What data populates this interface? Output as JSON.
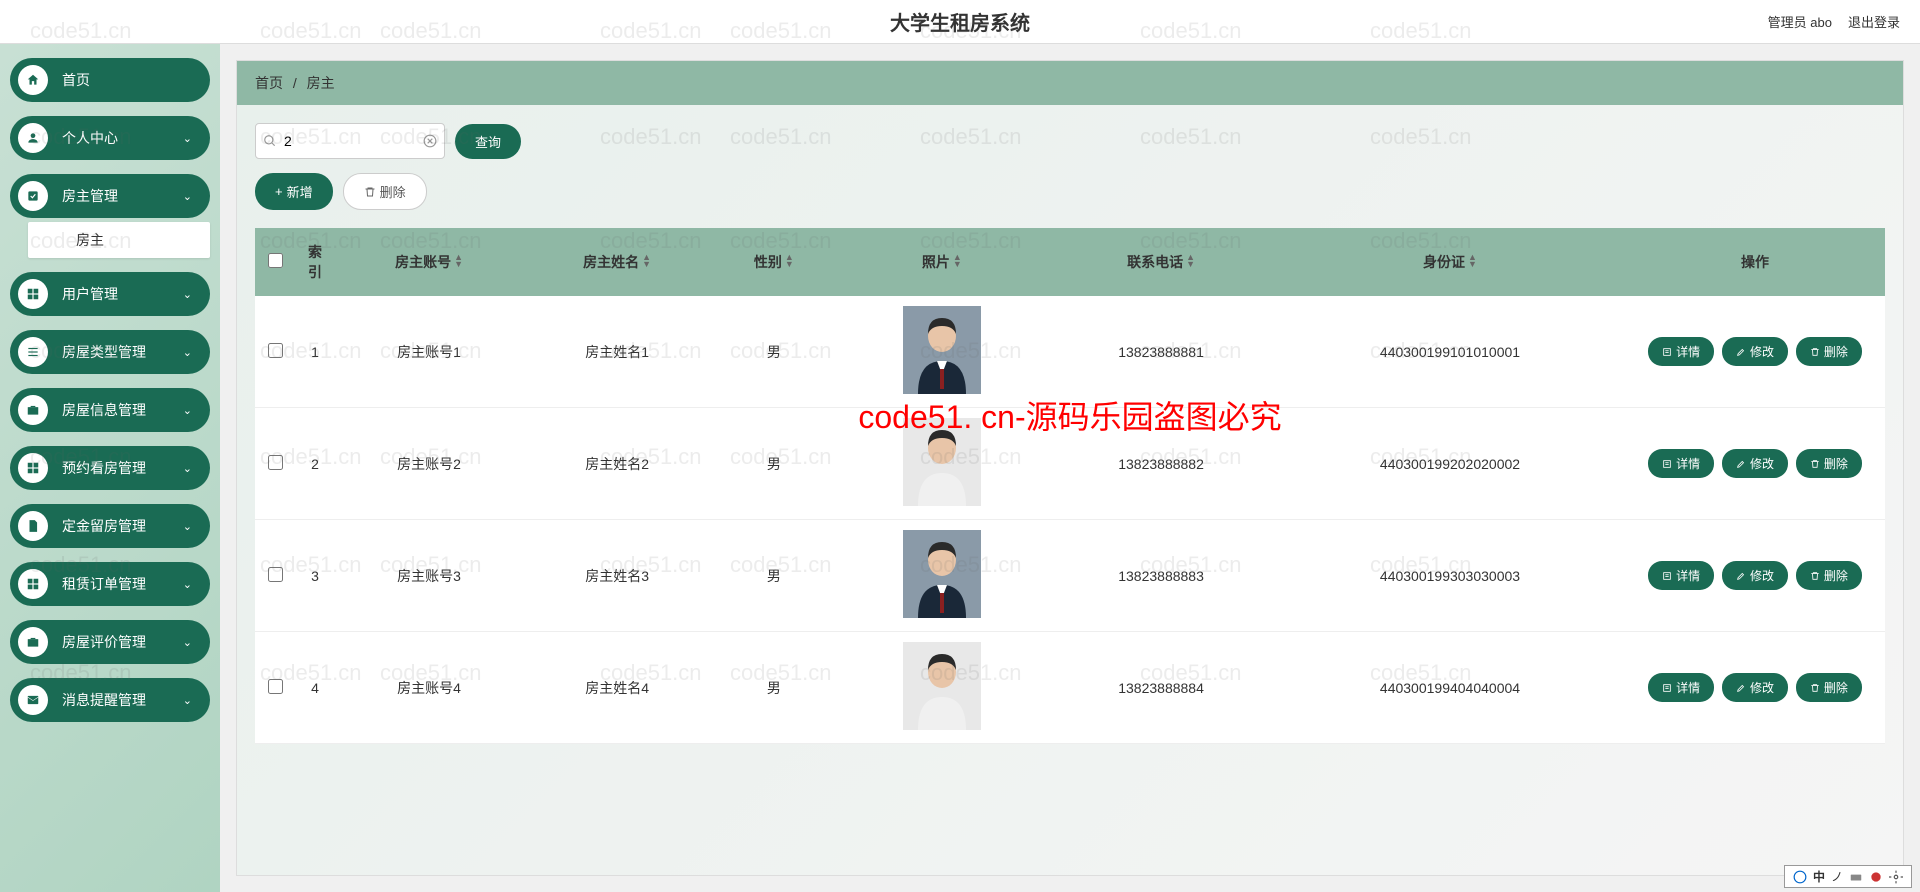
{
  "header": {
    "title": "大学生租房系统",
    "admin_label": "管理员",
    "admin_name": "abo",
    "logout": "退出登录"
  },
  "sidebar": {
    "items": [
      {
        "label": "首页",
        "icon": "home"
      },
      {
        "label": "个人中心",
        "icon": "user"
      },
      {
        "label": "房主管理",
        "icon": "check",
        "expanded": true,
        "sub": "房主"
      },
      {
        "label": "用户管理",
        "icon": "grid"
      },
      {
        "label": "房屋类型管理",
        "icon": "list"
      },
      {
        "label": "房屋信息管理",
        "icon": "case"
      },
      {
        "label": "预约看房管理",
        "icon": "grid"
      },
      {
        "label": "定金留房管理",
        "icon": "doc"
      },
      {
        "label": "租赁订单管理",
        "icon": "grid"
      },
      {
        "label": "房屋评价管理",
        "icon": "case"
      },
      {
        "label": "消息提醒管理",
        "icon": "mail"
      }
    ]
  },
  "breadcrumb": {
    "home": "首页",
    "current": "房主"
  },
  "search": {
    "value": "2",
    "placeholder": ""
  },
  "buttons": {
    "query": "查询",
    "add": "新增",
    "delete": "删除",
    "detail": "详情",
    "edit": "修改",
    "del": "删除"
  },
  "table": {
    "headers": [
      "索引",
      "房主账号",
      "房主姓名",
      "性别",
      "照片",
      "联系电话",
      "身份证",
      "操作"
    ],
    "rows": [
      {
        "idx": "1",
        "account": "房主账号1",
        "name": "房主姓名1",
        "gender": "男",
        "phone": "13823888881",
        "idcard": "440300199101010001",
        "m": true
      },
      {
        "idx": "2",
        "account": "房主账号2",
        "name": "房主姓名2",
        "gender": "男",
        "phone": "13823888882",
        "idcard": "440300199202020002",
        "m": false
      },
      {
        "idx": "3",
        "account": "房主账号3",
        "name": "房主姓名3",
        "gender": "男",
        "phone": "13823888883",
        "idcard": "440300199303030003",
        "m": true
      },
      {
        "idx": "4",
        "account": "房主账号4",
        "name": "房主姓名4",
        "gender": "男",
        "phone": "13823888884",
        "idcard": "440300199404040004",
        "m": false
      }
    ]
  },
  "watermark_red": "code51. cn-源码乐园盗图必究",
  "watermark_bg": "code51.cn",
  "ime": {
    "text": "中",
    "dot": "ノ"
  }
}
